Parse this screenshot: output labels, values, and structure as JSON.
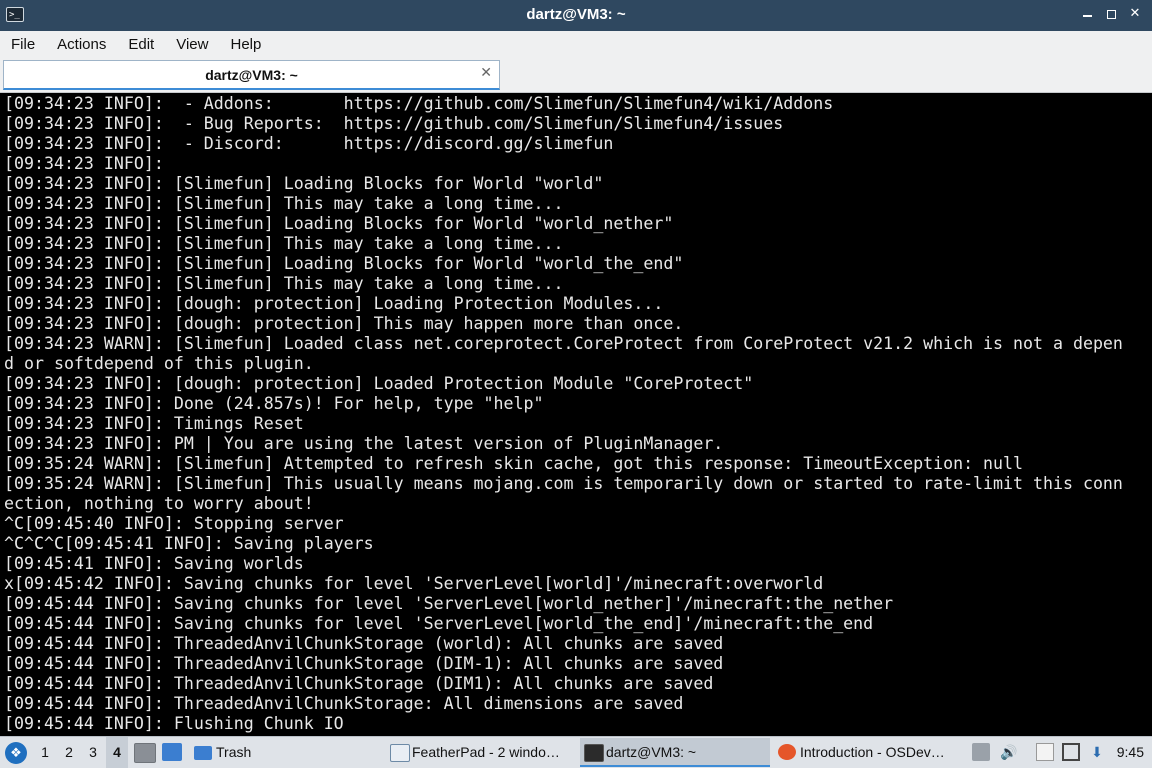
{
  "window": {
    "title": "dartz@VM3: ~",
    "app_icon_glyph": ">_"
  },
  "menu": [
    "File",
    "Actions",
    "Edit",
    "View",
    "Help"
  ],
  "tab": {
    "title": "dartz@VM3: ~",
    "close_glyph": "✕"
  },
  "terminal_lines": [
    "[09:34:23 INFO]:  - Addons:       https://github.com/Slimefun/Slimefun4/wiki/Addons",
    "[09:34:23 INFO]:  - Bug Reports:  https://github.com/Slimefun/Slimefun4/issues",
    "[09:34:23 INFO]:  - Discord:      https://discord.gg/slimefun",
    "[09:34:23 INFO]:",
    "[09:34:23 INFO]: [Slimefun] Loading Blocks for World \"world\"",
    "[09:34:23 INFO]: [Slimefun] This may take a long time...",
    "[09:34:23 INFO]: [Slimefun] Loading Blocks for World \"world_nether\"",
    "[09:34:23 INFO]: [Slimefun] This may take a long time...",
    "[09:34:23 INFO]: [Slimefun] Loading Blocks for World \"world_the_end\"",
    "[09:34:23 INFO]: [Slimefun] This may take a long time...",
    "[09:34:23 INFO]: [dough: protection] Loading Protection Modules...",
    "[09:34:23 INFO]: [dough: protection] This may happen more than once.",
    "[09:34:23 WARN]: [Slimefun] Loaded class net.coreprotect.CoreProtect from CoreProtect v21.2 which is not a depen",
    "d or softdepend of this plugin.",
    "[09:34:23 INFO]: [dough: protection] Loaded Protection Module \"CoreProtect\"",
    "[09:34:23 INFO]: Done (24.857s)! For help, type \"help\"",
    "[09:34:23 INFO]: Timings Reset",
    "[09:34:23 INFO]: PM | You are using the latest version of PluginManager.",
    "[09:35:24 WARN]: [Slimefun] Attempted to refresh skin cache, got this response: TimeoutException: null",
    "[09:35:24 WARN]: [Slimefun] This usually means mojang.com is temporarily down or started to rate-limit this conn",
    "ection, nothing to worry about!",
    "^C[09:45:40 INFO]: Stopping server",
    "^C^C^C[09:45:41 INFO]: Saving players",
    "[09:45:41 INFO]: Saving worlds",
    "x[09:45:42 INFO]: Saving chunks for level 'ServerLevel[world]'/minecraft:overworld",
    "[09:45:44 INFO]: Saving chunks for level 'ServerLevel[world_nether]'/minecraft:the_nether",
    "[09:45:44 INFO]: Saving chunks for level 'ServerLevel[world_the_end]'/minecraft:the_end",
    "[09:45:44 INFO]: ThreadedAnvilChunkStorage (world): All chunks are saved",
    "[09:45:44 INFO]: ThreadedAnvilChunkStorage (DIM-1): All chunks are saved",
    "[09:45:44 INFO]: ThreadedAnvilChunkStorage (DIM1): All chunks are saved",
    "[09:45:44 INFO]: ThreadedAnvilChunkStorage: All dimensions are saved",
    "[09:45:44 INFO]: Flushing Chunk IO"
  ],
  "taskbar": {
    "workspaces": [
      "1",
      "2",
      "3",
      "4"
    ],
    "active_workspace": "4",
    "trash_label": "Trash",
    "tasks": [
      {
        "label": "FeatherPad - 2 windo…",
        "icon": "featherpad-icon"
      },
      {
        "label": "dartz@VM3: ~",
        "icon": "terminal-icon"
      },
      {
        "label": "Introduction - OSDev…",
        "icon": "firefox-icon"
      }
    ],
    "clock": "9:45"
  },
  "colors": {
    "titlebar": "#2f4860",
    "terminal_bg": "#000000",
    "terminal_fg": "#e8e8e8",
    "accent": "#3d8cd6",
    "panel": "#dfe3e8"
  }
}
